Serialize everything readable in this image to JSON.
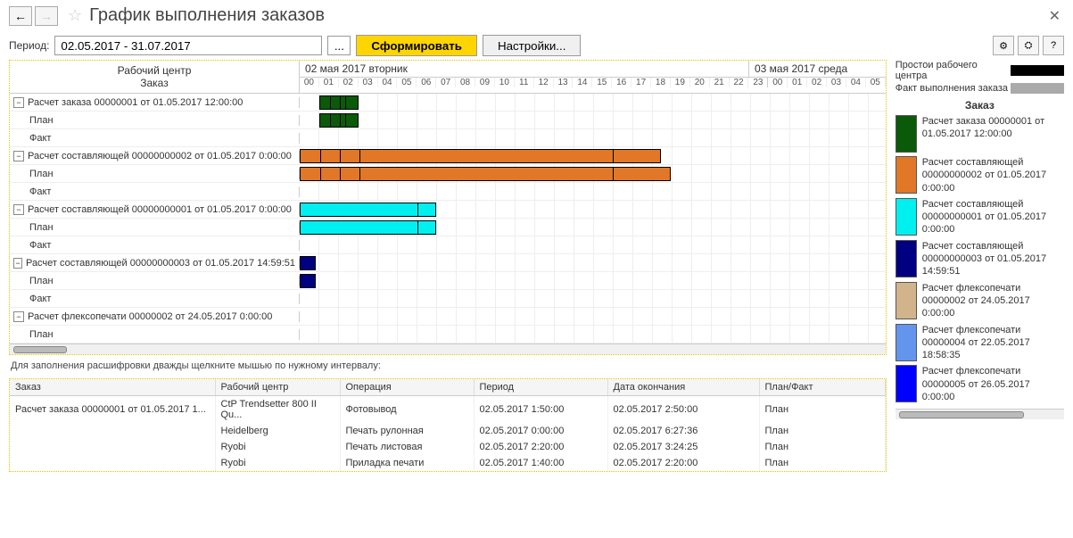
{
  "header": {
    "title": "График выполнения заказов"
  },
  "toolbar": {
    "period_label": "Период:",
    "period_value": "02.05.2017 - 31.07.2017",
    "form_btn": "Сформировать",
    "settings_btn": "Настройки...",
    "help_btn": "?"
  },
  "gantt": {
    "left_head_line1": "Рабочий центр",
    "left_head_line2": "Заказ",
    "dates": [
      "02 мая 2017 вторник",
      "03 мая 2017 среда"
    ],
    "hours": [
      "00",
      "01",
      "02",
      "03",
      "04",
      "05",
      "06",
      "07",
      "08",
      "09",
      "10",
      "11",
      "12",
      "13",
      "14",
      "15",
      "16",
      "17",
      "18",
      "19",
      "20",
      "21",
      "22",
      "23",
      "00",
      "01",
      "02",
      "03",
      "04",
      "05"
    ],
    "rows": [
      {
        "label": "Расчет заказа 00000001 от 01.05.2017 12:00:00",
        "toggle": true,
        "bar": {
          "color": "c-green",
          "start": 1,
          "end": 3,
          "segs": [
            1.5,
            2,
            2.3
          ]
        }
      },
      {
        "label": "План",
        "indent": true,
        "bar": {
          "color": "c-green",
          "start": 1,
          "end": 3,
          "segs": [
            1.5,
            2,
            2.3
          ]
        }
      },
      {
        "label": "Факт",
        "indent": true
      },
      {
        "label": "Расчет составляющей 00000000002 от 01.05.2017 0:00:00",
        "toggle": true,
        "bar": {
          "color": "c-orange",
          "start": 0,
          "end": 18.5,
          "segs": [
            1,
            2,
            3,
            16
          ]
        }
      },
      {
        "label": "План",
        "indent": true,
        "bar": {
          "color": "c-orange",
          "start": 0,
          "end": 19,
          "segs": [
            1,
            2,
            3,
            16
          ]
        }
      },
      {
        "label": "Факт",
        "indent": true
      },
      {
        "label": "Расчет составляющей 00000000001 от 01.05.2017 0:00:00",
        "toggle": true,
        "bar": {
          "color": "c-cyan",
          "start": 0,
          "end": 7,
          "segs": [
            6
          ]
        }
      },
      {
        "label": "План",
        "indent": true,
        "bar": {
          "color": "c-cyan",
          "start": 0,
          "end": 7,
          "segs": [
            6
          ]
        }
      },
      {
        "label": "Факт",
        "indent": true
      },
      {
        "label": "Расчет составляющей 00000000003 от 01.05.2017 14:59:51",
        "toggle": true,
        "bar": {
          "color": "c-navy",
          "start": 0,
          "end": 0.8
        }
      },
      {
        "label": "План",
        "indent": true,
        "bar": {
          "color": "c-navy",
          "start": 0,
          "end": 0.8
        }
      },
      {
        "label": "Факт",
        "indent": true
      },
      {
        "label": "Расчет флексопечати 00000002 от 24.05.2017 0:00:00",
        "toggle": true
      },
      {
        "label": "План",
        "indent": true
      }
    ]
  },
  "hint": "Для заполнения расшифровки дважды щелкните мышью по нужному интервалу:",
  "detail": {
    "headers": [
      "Заказ",
      "Рабочий центр",
      "Операция",
      "Период",
      "Дата окончания",
      "План/Факт"
    ],
    "rows": [
      [
        "Расчет заказа 00000001 от 01.05.2017 1...",
        "CtP Trendsetter 800 II Qu...",
        "Фотовывод",
        "02.05.2017 1:50:00",
        "02.05.2017 2:50:00",
        "План"
      ],
      [
        "",
        "Heidelberg",
        "Печать рулонная",
        "02.05.2017 0:00:00",
        "02.05.2017 6:27:36",
        "План"
      ],
      [
        "",
        "Ryobi",
        "Печать листовая",
        "02.05.2017 2:20:00",
        "02.05.2017 3:24:25",
        "План"
      ],
      [
        "",
        "Ryobi",
        "Приладка печати",
        "02.05.2017 1:40:00",
        "02.05.2017 2:20:00",
        "План"
      ]
    ]
  },
  "legend": {
    "downtime_label": "Простои рабочего центра",
    "fact_label": "Факт выполнения заказа",
    "title": "Заказ",
    "items": [
      {
        "color": "c-green",
        "text": "Расчет заказа 00000001 от 01.05.2017 12:00:00"
      },
      {
        "color": "c-orange",
        "text": "Расчет составляющей 00000000002 от 01.05.2017 0:00:00"
      },
      {
        "color": "c-cyan",
        "text": "Расчет составляющей 00000000001 от 01.05.2017 0:00:00"
      },
      {
        "color": "c-navy",
        "text": "Расчет составляющей 00000000003 от 01.05.2017 14:59:51"
      },
      {
        "color": "c-tan",
        "text": "Расчет флексопечати 00000002 от 24.05.2017 0:00:00"
      },
      {
        "color": "c-steel",
        "text": "Расчет флексопечати 00000004 от 22.05.2017 18:58:35"
      },
      {
        "color": "c-blue",
        "text": "Расчет флексопечати 00000005 от 26.05.2017 0:00:00"
      }
    ]
  }
}
